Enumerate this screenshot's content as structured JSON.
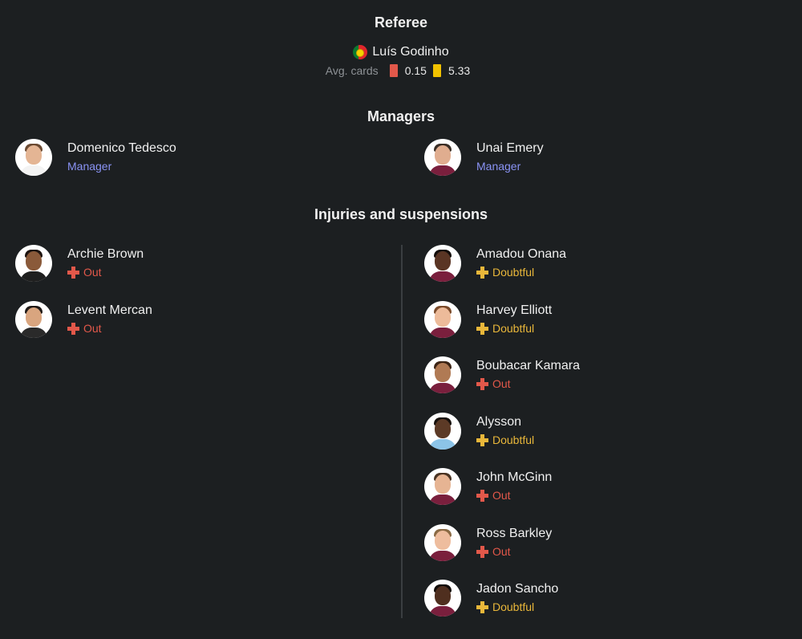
{
  "referee": {
    "title": "Referee",
    "name": "Luís Godinho",
    "country_flag": "portugal-flag",
    "avg_cards_label": "Avg. cards",
    "red_avg": "0.15",
    "yellow_avg": "5.33",
    "colors": {
      "red_card": "#e2584a",
      "yellow_card": "#f2c200"
    }
  },
  "managers": {
    "title": "Managers",
    "home": {
      "name": "Domenico Tedesco",
      "role": "Manager"
    },
    "away": {
      "name": "Unai Emery",
      "role": "Manager"
    }
  },
  "injuries": {
    "title": "Injuries and suspensions",
    "home": [
      {
        "name": "Archie Brown",
        "status": "Out"
      },
      {
        "name": "Levent Mercan",
        "status": "Out"
      }
    ],
    "away": [
      {
        "name": "Amadou Onana",
        "status": "Doubtful"
      },
      {
        "name": "Harvey Elliott",
        "status": "Doubtful"
      },
      {
        "name": "Boubacar Kamara",
        "status": "Out"
      },
      {
        "name": "Alysson",
        "status": "Doubtful"
      },
      {
        "name": "John McGinn",
        "status": "Out"
      },
      {
        "name": "Ross Barkley",
        "status": "Out"
      },
      {
        "name": "Jadon Sancho",
        "status": "Doubtful"
      }
    ],
    "colors": {
      "out": "#e2584a",
      "doubtful": "#e9b73a"
    }
  },
  "colors": {
    "background": "#1c1f21",
    "manager_role": "#8a93f5"
  }
}
